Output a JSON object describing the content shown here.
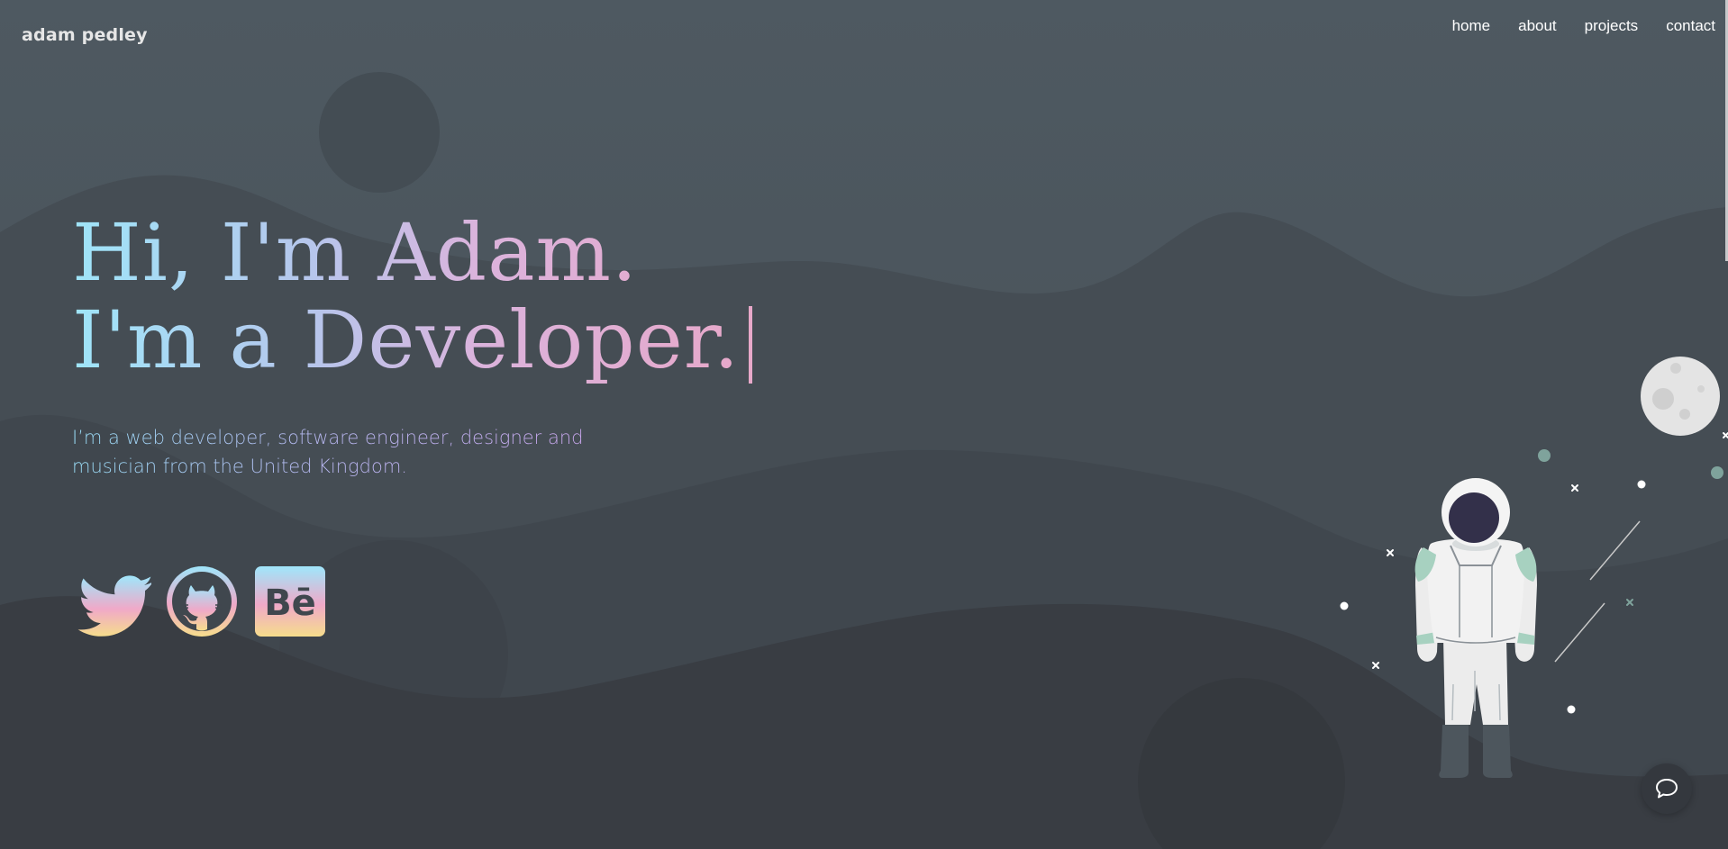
{
  "header": {
    "brand": "adam pedley",
    "nav": [
      {
        "label": "home"
      },
      {
        "label": "about"
      },
      {
        "label": "projects"
      },
      {
        "label": "contact"
      }
    ]
  },
  "hero": {
    "line1": "Hi, I'm Adam.",
    "line2": "I'm a Developer.",
    "bio": "I’m a web developer, software engineer, designer and musician from the United Kingdom."
  },
  "socials": [
    {
      "name": "twitter",
      "icon": "twitter-bird-icon"
    },
    {
      "name": "github",
      "icon": "github-octocat-icon"
    },
    {
      "name": "behance",
      "icon": "behance-icon",
      "glyph": "Bē"
    }
  ],
  "colors": {
    "background": "#4b555c",
    "gradient_start": "#9fe5f9",
    "gradient_end": "#e7a8c9",
    "social_gradient_bottom": "#f5dc8a"
  },
  "chat": {
    "icon": "chat-bubble-icon"
  }
}
